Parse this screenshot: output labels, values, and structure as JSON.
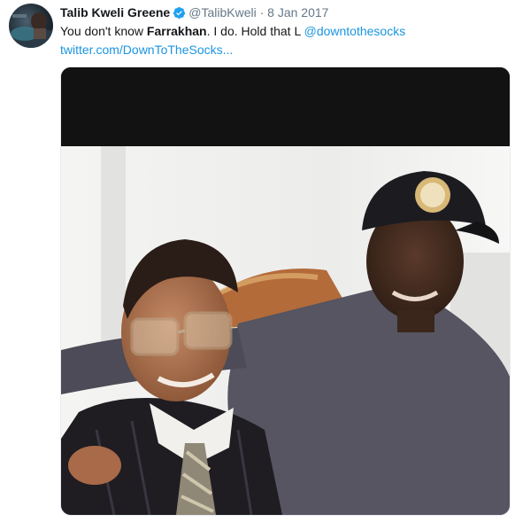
{
  "tweet": {
    "author_name": "Talib Kweli Greene",
    "verified_icon": "verified-badge-icon",
    "handle": "@TalibKweli",
    "separator": "·",
    "date": "8 Jan 2017",
    "text_prefix": "You don't know ",
    "text_bold": "Farrakhan",
    "text_mid": ". I do. Hold that L ",
    "mention": "@downtothesocks",
    "url": "twitter.com/DownToTheSocks..."
  },
  "colors": {
    "link": "#1b95e0",
    "secondary": "#657786",
    "verified": "#1da1f2"
  }
}
